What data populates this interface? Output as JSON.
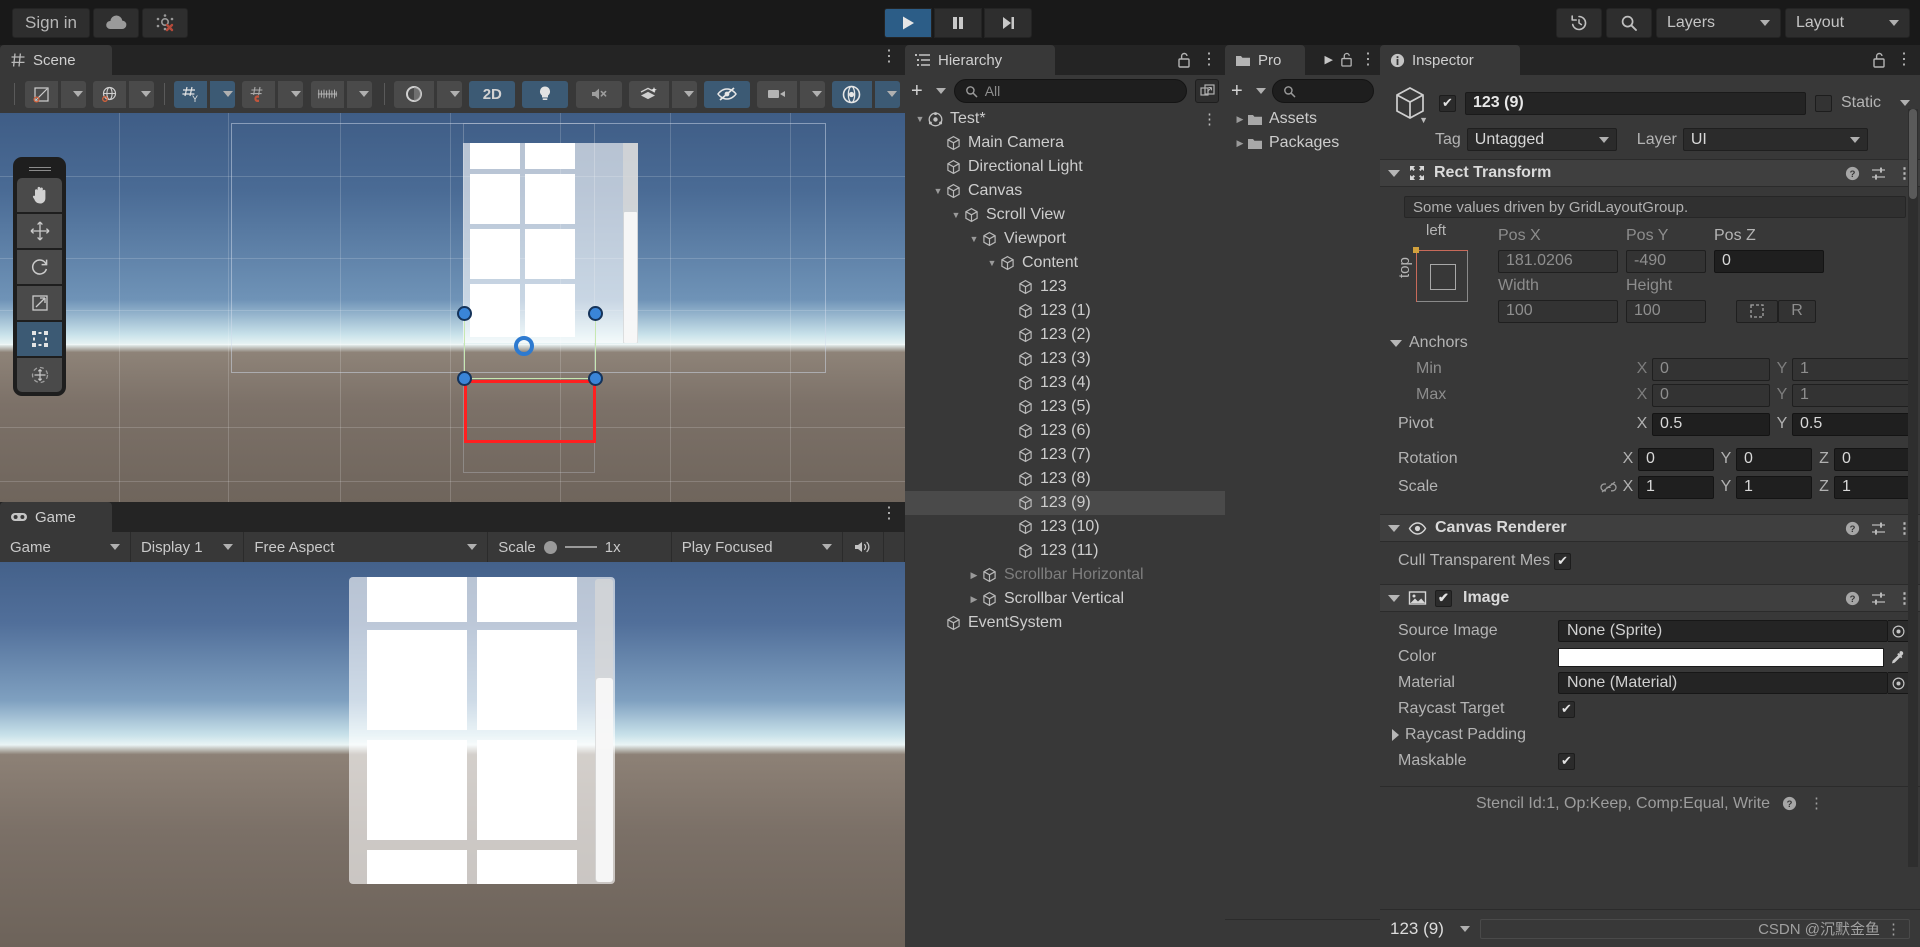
{
  "toolbar": {
    "signin_label": "Sign in",
    "cloud_icon": "cloud-icon",
    "collab_icon": "collab-error-icon",
    "play_icon": "play-icon",
    "pause_icon": "pause-icon",
    "step_icon": "step-icon",
    "history_icon": "undo-history-icon",
    "search_icon": "search-icon",
    "layers_label": "Layers",
    "layout_label": "Layout"
  },
  "scene": {
    "tab_label": "Scene",
    "tab_icon": "grid-icon",
    "tools": {
      "pivot_rotation_icon": "pivot-center-icon",
      "global_local_icon": "globe-icon",
      "grid_icon": "grid-y-axis-icon",
      "snap_icon": "grid-snap-icon",
      "ruler_icon": "ruler-icon",
      "shading_icon": "shading-sphere-icon",
      "twod_label": "2D",
      "light_icon": "lightbulb-icon",
      "audio_icon": "audio-mute-icon",
      "fx_icon": "effects-icon",
      "hidden_icon": "visibility-off-icon",
      "camera_icon": "camera-icon",
      "gizmos_icon": "gizmos-icon"
    },
    "palette": [
      {
        "name": "hand-tool",
        "icon": "hand-icon",
        "active": false
      },
      {
        "name": "move-tool",
        "icon": "move-icon",
        "active": false
      },
      {
        "name": "rotate-tool",
        "icon": "rotate-icon",
        "active": false
      },
      {
        "name": "scale-tool",
        "icon": "scale-icon",
        "active": false
      },
      {
        "name": "rect-tool",
        "icon": "rect-transform-icon",
        "active": true
      },
      {
        "name": "transform-tool",
        "icon": "transform-icon",
        "active": false
      }
    ]
  },
  "game": {
    "tab_label": "Game",
    "tab_icon": "game-goggles-icon",
    "target_label": "Game",
    "display_label": "Display 1",
    "aspect_label": "Free Aspect",
    "scale_label": "Scale",
    "scale_value": "1x",
    "play_mode_label": "Play Focused",
    "mute_icon": "speaker-icon"
  },
  "hierarchy": {
    "tab_label": "Hierarchy",
    "tab_icon": "hierarchy-icon",
    "lock_icon": "lock-open-icon",
    "menu_icon": "kebab-menu-icon",
    "add_label": "+",
    "search_placeholder": "All",
    "items": [
      {
        "label": "Test*",
        "depth": 0,
        "arrow": "down",
        "icon": "scene-icon",
        "selected": false,
        "dim": false
      },
      {
        "label": "Main Camera",
        "depth": 1,
        "arrow": "none",
        "icon": "gameobject-icon",
        "selected": false,
        "dim": false
      },
      {
        "label": "Directional Light",
        "depth": 1,
        "arrow": "none",
        "icon": "gameobject-icon",
        "selected": false,
        "dim": false
      },
      {
        "label": "Canvas",
        "depth": 1,
        "arrow": "down",
        "icon": "gameobject-icon",
        "selected": false,
        "dim": false
      },
      {
        "label": "Scroll View",
        "depth": 2,
        "arrow": "down",
        "icon": "gameobject-icon",
        "selected": false,
        "dim": false
      },
      {
        "label": "Viewport",
        "depth": 3,
        "arrow": "down",
        "icon": "gameobject-icon",
        "selected": false,
        "dim": false
      },
      {
        "label": "Content",
        "depth": 4,
        "arrow": "down",
        "icon": "gameobject-icon",
        "selected": false,
        "dim": false
      },
      {
        "label": "123",
        "depth": 5,
        "arrow": "none",
        "icon": "gameobject-icon",
        "selected": false,
        "dim": false
      },
      {
        "label": "123 (1)",
        "depth": 5,
        "arrow": "none",
        "icon": "gameobject-icon",
        "selected": false,
        "dim": false
      },
      {
        "label": "123 (2)",
        "depth": 5,
        "arrow": "none",
        "icon": "gameobject-icon",
        "selected": false,
        "dim": false
      },
      {
        "label": "123 (3)",
        "depth": 5,
        "arrow": "none",
        "icon": "gameobject-icon",
        "selected": false,
        "dim": false
      },
      {
        "label": "123 (4)",
        "depth": 5,
        "arrow": "none",
        "icon": "gameobject-icon",
        "selected": false,
        "dim": false
      },
      {
        "label": "123 (5)",
        "depth": 5,
        "arrow": "none",
        "icon": "gameobject-icon",
        "selected": false,
        "dim": false
      },
      {
        "label": "123 (6)",
        "depth": 5,
        "arrow": "none",
        "icon": "gameobject-icon",
        "selected": false,
        "dim": false
      },
      {
        "label": "123 (7)",
        "depth": 5,
        "arrow": "none",
        "icon": "gameobject-icon",
        "selected": false,
        "dim": false
      },
      {
        "label": "123 (8)",
        "depth": 5,
        "arrow": "none",
        "icon": "gameobject-icon",
        "selected": false,
        "dim": false
      },
      {
        "label": "123 (9)",
        "depth": 5,
        "arrow": "none",
        "icon": "gameobject-icon",
        "selected": true,
        "dim": false
      },
      {
        "label": "123 (10)",
        "depth": 5,
        "arrow": "none",
        "icon": "gameobject-icon",
        "selected": false,
        "dim": false
      },
      {
        "label": "123 (11)",
        "depth": 5,
        "arrow": "none",
        "icon": "gameobject-icon",
        "selected": false,
        "dim": false
      },
      {
        "label": "Scrollbar Horizontal",
        "depth": 3,
        "arrow": "right",
        "icon": "gameobject-icon",
        "selected": false,
        "dim": true
      },
      {
        "label": "Scrollbar Vertical",
        "depth": 3,
        "arrow": "right",
        "icon": "gameobject-icon",
        "selected": false,
        "dim": false
      },
      {
        "label": "EventSystem",
        "depth": 1,
        "arrow": "none",
        "icon": "gameobject-icon",
        "selected": false,
        "dim": false
      }
    ]
  },
  "project": {
    "tab_label": "Pro",
    "tab_icon": "folder-icon",
    "lock_icon": "lock-open-icon",
    "menu_icon": "kebab-menu-icon",
    "overflow_icon": "chevron-right-icon",
    "add_label": "+",
    "search_placeholder": "",
    "items": [
      {
        "label": "Assets",
        "arrow": "right"
      },
      {
        "label": "Packages",
        "arrow": "right"
      }
    ]
  },
  "inspector": {
    "tab_label": "Inspector",
    "tab_icon": "info-icon",
    "lock_icon": "lock-open-icon",
    "menu_icon": "kebab-menu-icon",
    "object_name": "123 (9)",
    "object_enabled": true,
    "static_label": "Static",
    "static_checked": false,
    "tag_label": "Tag",
    "tag_value": "Untagged",
    "layer_label": "Layer",
    "layer_value": "UI",
    "rect_transform": {
      "title": "Rect Transform",
      "driven_note": "Some values driven by GridLayoutGroup.",
      "anchor_preset_top": "top",
      "anchor_preset_left": "left",
      "pos_x_label": "Pos X",
      "pos_x_value": "181.0206",
      "pos_y_label": "Pos Y",
      "pos_y_value": "-490",
      "pos_z_label": "Pos Z",
      "pos_z_value": "0",
      "width_label": "Width",
      "width_value": "100",
      "height_label": "Height",
      "height_value": "100",
      "blueprint_icon": "blueprint-icon",
      "raw_label": "R",
      "anchors_label": "Anchors",
      "min_label": "Min",
      "min_x": "0",
      "min_y": "1",
      "max_label": "Max",
      "max_x": "0",
      "max_y": "1",
      "pivot_label": "Pivot",
      "pivot_x": "0.5",
      "pivot_y": "0.5",
      "rotation_label": "Rotation",
      "rot_x": "0",
      "rot_y": "0",
      "rot_z": "0",
      "scale_label": "Scale",
      "scale_x": "1",
      "scale_y": "1",
      "scale_z": "1",
      "scale_link_icon": "link-off-icon"
    },
    "canvas_renderer": {
      "title": "Canvas Renderer",
      "icon": "eye-icon",
      "cull_label": "Cull Transparent Mes",
      "cull_checked": true
    },
    "image": {
      "title": "Image",
      "icon": "image-icon",
      "enabled": true,
      "source_image_label": "Source Image",
      "source_image_value": "None (Sprite)",
      "color_label": "Color",
      "color_value": "#FFFFFF",
      "material_label": "Material",
      "material_value": "None (Material)",
      "raycast_target_label": "Raycast Target",
      "raycast_target_checked": true,
      "raycast_padding_label": "Raycast Padding",
      "maskable_label": "Maskable",
      "maskable_checked": true,
      "picker_icon": "eyedropper-icon",
      "object_picker_icon": "object-picker-icon"
    },
    "stencil_note": "Stencil Id:1, Op:Keep, Comp:Equal, Write",
    "footer_object": "123 (9)",
    "watermark": "CSDN @沉默金鱼"
  },
  "colors": {
    "accent_blue": "#2c5d87",
    "panel_bg": "#383838",
    "toolbar_bg": "#191919",
    "selection_red": "#ff2020",
    "handle_blue": "#3a85d8"
  }
}
